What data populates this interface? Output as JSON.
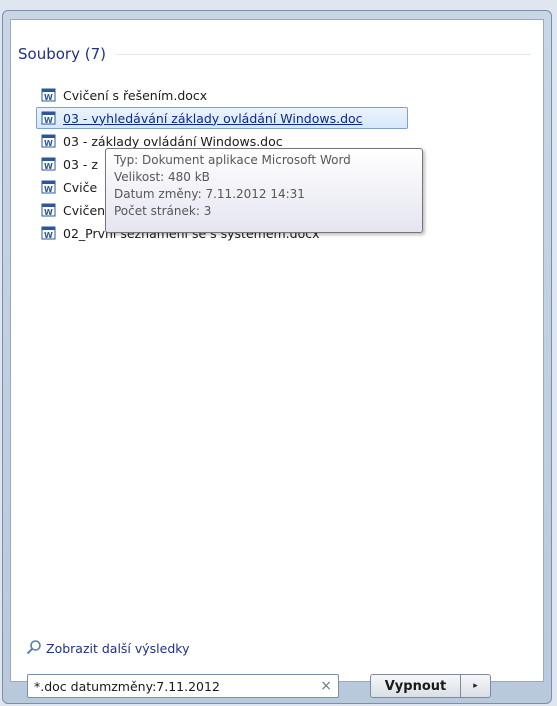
{
  "section": {
    "title": "Soubory (7)"
  },
  "results": [
    {
      "label": "Cvičení s řešením.docx"
    },
    {
      "label": "03 - vyhledávání základy ovládání Windows.doc"
    },
    {
      "label": "03 - základy ovládání Windows.doc"
    },
    {
      "label": "03 - z"
    },
    {
      "label": "Cviče"
    },
    {
      "label": "Cvičení s řešením.doc"
    },
    {
      "label": "02_První seznámení se s systémem.docx"
    }
  ],
  "tooltip": {
    "lines": [
      "Typ: Dokument aplikace Microsoft Word",
      "Velikost: 480 kB",
      "Datum změny: 7.11.2012 14:31",
      "Počet stránek: 3"
    ]
  },
  "more_results": {
    "label": "Zobrazit další výsledky"
  },
  "search": {
    "value": "*.doc datumzměny:7.11.2012",
    "clear_glyph": "×"
  },
  "shutdown": {
    "label": "Vypnout",
    "arrow_glyph": "▸"
  },
  "colors": {
    "accent_title": "#1e3287",
    "selection_border": "#7da2ce"
  },
  "icons": {
    "document": "word-document-icon",
    "search": "search-icon"
  }
}
